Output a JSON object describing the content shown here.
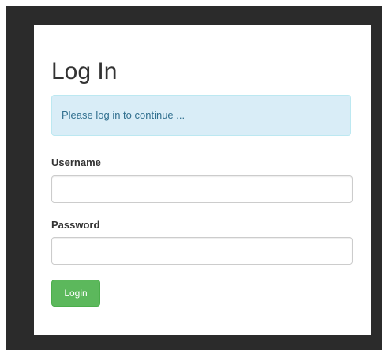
{
  "login": {
    "title": "Log In",
    "alert_text": "Please log in to continue ...",
    "username_label": "Username",
    "username_value": "",
    "password_label": "Password",
    "password_value": "",
    "login_button": "Login"
  },
  "colors": {
    "frame": "#2b2b2b",
    "alert_background": "#d9edf7",
    "alert_text": "#31708f",
    "button_background": "#5cb85c"
  }
}
